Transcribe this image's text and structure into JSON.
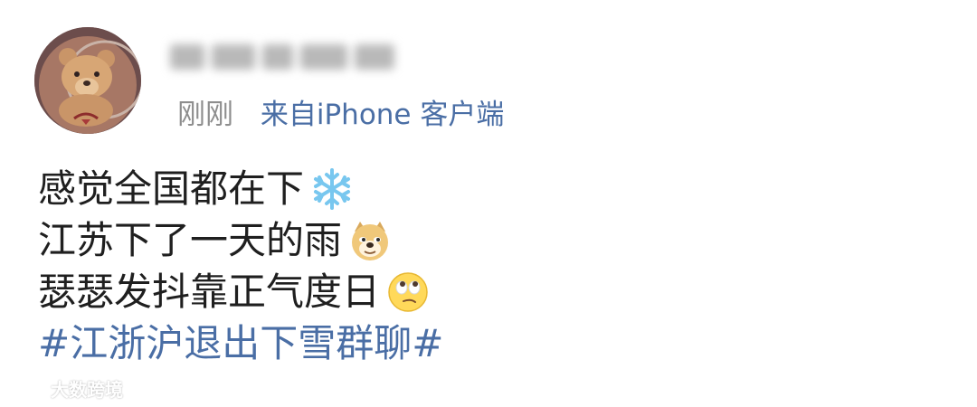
{
  "post": {
    "author": {
      "avatar_icon": "teddy-bear-avatar",
      "name_blurred": true
    },
    "meta": {
      "time": "刚刚",
      "source": "来自iPhone 客户端"
    },
    "lines": [
      {
        "text": "感觉全国都在下",
        "emoji": "snowflake-emoji"
      },
      {
        "text": "江苏下了一天的雨",
        "emoji": "doge-emoji"
      },
      {
        "text": "瑟瑟发抖靠正气度日",
        "emoji": "eye-roll-emoji"
      }
    ],
    "hashtag": "#江浙沪退出下雪群聊#"
  },
  "watermark": {
    "icon": "weibo-logo-icon",
    "text": "大数跨境"
  },
  "colors": {
    "text": "#1f1f1f",
    "meta": "#8e8e8e",
    "link": "#4a6ea5"
  }
}
